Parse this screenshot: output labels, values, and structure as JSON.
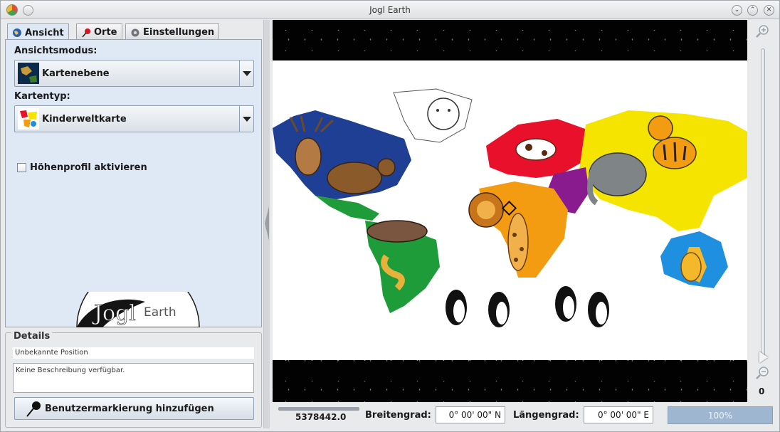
{
  "window": {
    "title": "Jogl Earth"
  },
  "tabs": [
    {
      "label": "Ansicht",
      "icon": "globe-icon"
    },
    {
      "label": "Orte",
      "icon": "pin-icon"
    },
    {
      "label": "Einstellungen",
      "icon": "gear-icon"
    }
  ],
  "ansicht": {
    "view_mode_label": "Ansichtsmodus:",
    "view_mode_value": "Kartenebene",
    "map_type_label": "Kartentyp:",
    "map_type_value": "Kinderweltkarte",
    "elevation_label": "Höhenprofil aktivieren",
    "elevation_checked": false
  },
  "logo": {
    "main": "Jogl",
    "sub": "Earth"
  },
  "details": {
    "legend": "Details",
    "position": "Unbekannte Position",
    "description": "Keine Beschreibung verfügbar.",
    "add_marker_label": "Benutzermarkierung hinzufügen"
  },
  "zoom": {
    "value": "0",
    "level_fraction": 0.02
  },
  "statusbar": {
    "altitude": "5378442.0",
    "latitude_label": "Breitengrad:",
    "latitude_value": "0° 00' 00\" N",
    "longitude_label": "Längengrad:",
    "longitude_value": "0° 00' 00\" E",
    "progress": "100%"
  },
  "colors": {
    "panel": "#dfe9f5",
    "progress": "#9fb6d1",
    "europe": "#e8102a",
    "asia": "#f4e400",
    "north_america": "#1e3f93",
    "south_america": "#1f9c3a",
    "africa": "#f39c12",
    "australia": "#1f8fe0",
    "middle_east": "#8a1b8f"
  }
}
